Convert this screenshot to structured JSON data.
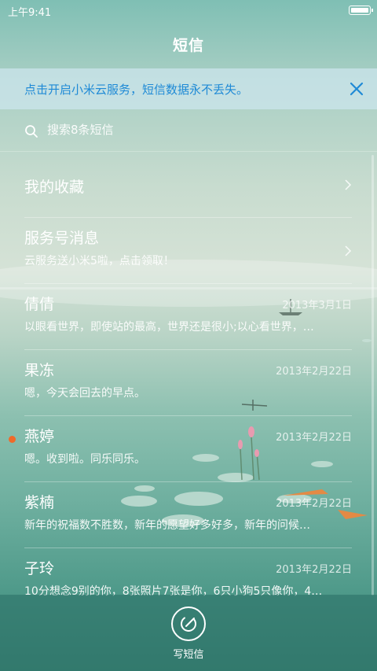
{
  "status_bar": {
    "time": "上午9:41"
  },
  "header": {
    "title": "短信"
  },
  "banner": {
    "text": "点击开启小米云服务，短信数据永不丢失。"
  },
  "search": {
    "placeholder": "搜索8条短信"
  },
  "conversations": [
    {
      "name": "我的收藏",
      "preview": "",
      "date": "",
      "has_chevron": true,
      "unread": false
    },
    {
      "name": "服务号消息",
      "preview": "云服务送小米5啦，点击领取！",
      "date": "",
      "has_chevron": true,
      "unread": false
    },
    {
      "name": "倩倩",
      "preview": "以眼看世界，即使站的最高，世界还是很小;以心看世界，…",
      "date": "2013年3月1日",
      "has_chevron": false,
      "unread": false
    },
    {
      "name": "果冻",
      "preview": "嗯，今天会回去的早点。",
      "date": "2013年2月22日",
      "has_chevron": false,
      "unread": false
    },
    {
      "name": "燕婷",
      "preview": "嗯。收到啦。同乐同乐。",
      "date": "2013年2月22日",
      "has_chevron": false,
      "unread": true
    },
    {
      "name": "紫楠",
      "preview": "新年的祝福数不胜数，新年的愿望好多好多，新年的问候…",
      "date": "2013年2月22日",
      "has_chevron": false,
      "unread": false
    },
    {
      "name": "子玲",
      "preview": "10分想念9别的你，8张照片7张是你，6只小狗5只像你，4…",
      "date": "2013年2月22日",
      "has_chevron": false,
      "unread": false
    }
  ],
  "compose": {
    "label": "写短信"
  },
  "colors": {
    "accent_blue": "#1f8ad6",
    "unread_dot": "#f06a2a"
  },
  "icons": {
    "search": "search-icon",
    "close": "close-icon",
    "chevron": "chevron-right-icon",
    "compose": "compose-icon"
  }
}
